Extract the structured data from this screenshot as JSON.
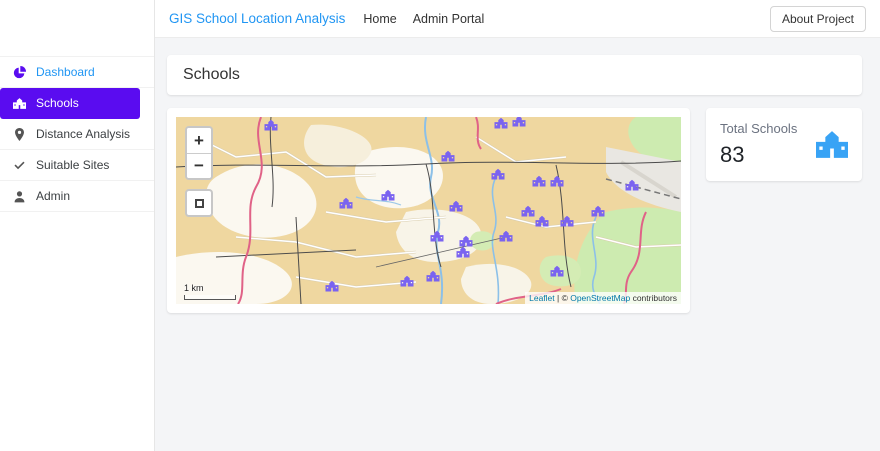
{
  "colors": {
    "accent": "#5a0cf0",
    "link": "#2196f3",
    "marker": "#7a63f0",
    "stat_icon": "#38a3f5"
  },
  "navbar": {
    "brand": "GIS School Location Analysis",
    "links": [
      "Home",
      "Admin Portal"
    ],
    "about_button": "About Project"
  },
  "sidebar": {
    "items": [
      {
        "label": "Dashboard",
        "icon": "dashboard",
        "active": false,
        "link_style": true
      },
      {
        "label": "Schools",
        "icon": "school",
        "active": true
      },
      {
        "label": "Distance Analysis",
        "icon": "pin",
        "active": false
      },
      {
        "label": "Suitable Sites",
        "icon": "check",
        "active": false
      },
      {
        "label": "Admin",
        "icon": "user",
        "active": false
      }
    ]
  },
  "page": {
    "title": "Schools"
  },
  "map": {
    "controls": {
      "zoom_in": "+",
      "zoom_out": "−",
      "fullscreen_icon": "fullscreen-icon"
    },
    "scale_label": "1 km",
    "attribution": {
      "leaflet": "Leaflet",
      "sep": " | © ",
      "osm": "OpenStreetMap",
      "suffix": " contributors"
    },
    "markers": [
      [
        18.8,
        6.4
      ],
      [
        64.4,
        5.3
      ],
      [
        67.9,
        4.3
      ],
      [
        53.9,
        23.0
      ],
      [
        63.8,
        32.6
      ],
      [
        71.9,
        36.4
      ],
      [
        75.4,
        36.4
      ],
      [
        90.3,
        38.5
      ],
      [
        33.7,
        48.1
      ],
      [
        42.0,
        43.9
      ],
      [
        55.4,
        49.7
      ],
      [
        69.7,
        52.4
      ],
      [
        72.5,
        57.8
      ],
      [
        77.4,
        57.8
      ],
      [
        51.7,
        65.8
      ],
      [
        57.4,
        68.4
      ],
      [
        65.3,
        65.8
      ],
      [
        83.6,
        52.4
      ],
      [
        30.9,
        92.5
      ],
      [
        45.7,
        89.8
      ],
      [
        50.9,
        87.2
      ],
      [
        75.4,
        84.5
      ],
      [
        56.8,
        74.3
      ]
    ]
  },
  "stats": {
    "title": "Total Schools",
    "value": "83"
  }
}
